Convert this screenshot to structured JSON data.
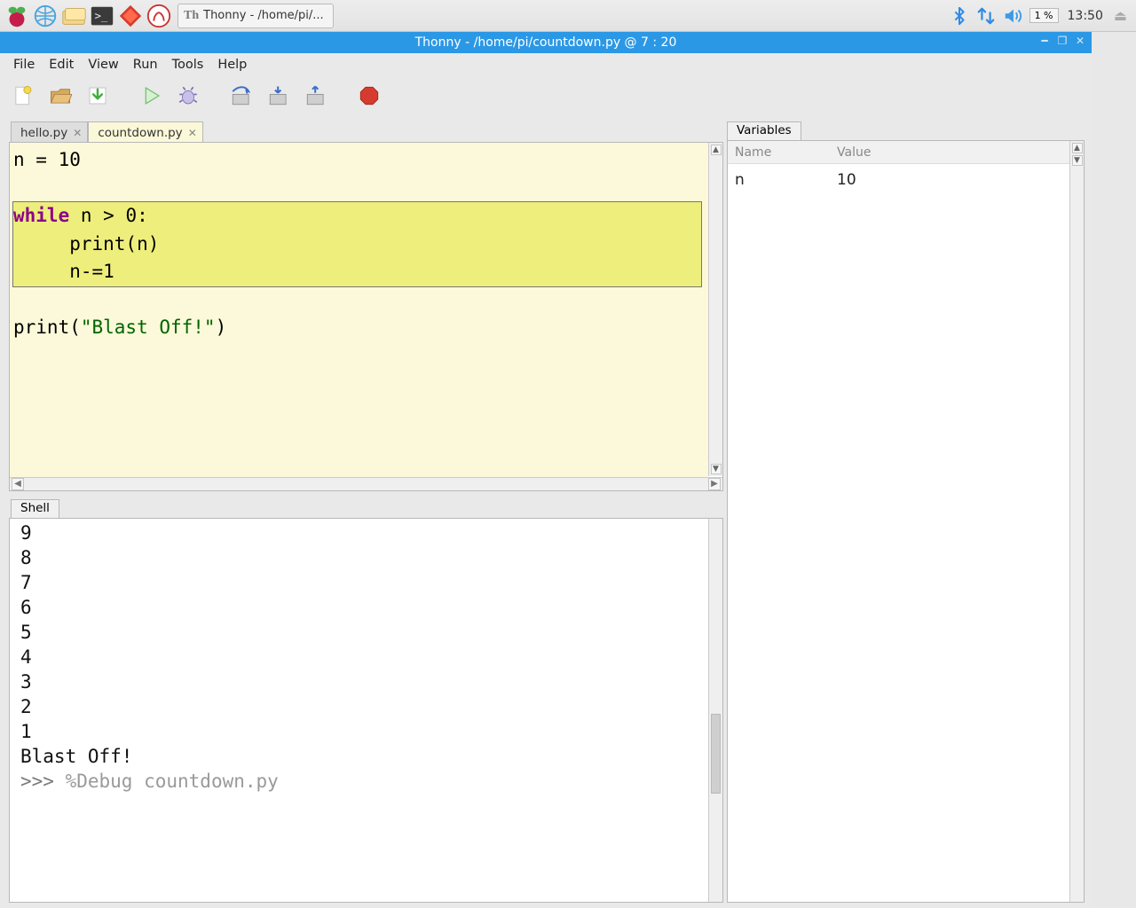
{
  "taskbar": {
    "task_label": "Thonny  -  /home/pi/...",
    "cpu": "1 %",
    "clock": "13:50"
  },
  "window": {
    "title": "Thonny  -  /home/pi/countdown.py  @  7 : 20"
  },
  "menu": {
    "file": "File",
    "edit": "Edit",
    "view": "View",
    "run": "Run",
    "tools": "Tools",
    "help": "Help"
  },
  "editor": {
    "tabs": [
      {
        "label": "hello.py",
        "active": false
      },
      {
        "label": "countdown.py",
        "active": true
      }
    ],
    "code": {
      "l1_a": "n = ",
      "l1_b": "10",
      "l3_kw": "while",
      "l3_rest": " n > ",
      "l3_num": "0",
      "l3_colon": ":",
      "l4": "     print(n)",
      "l5": "     n-=",
      "l5_num": "1",
      "l7_a": "print(",
      "l7_str": "\"Blast Off!\"",
      "l7_b": ")"
    }
  },
  "shell": {
    "tab": "Shell",
    "lines": [
      "9",
      "8",
      "7",
      "6",
      "5",
      "4",
      "3",
      "2",
      "1",
      "Blast Off!"
    ],
    "prompt": ">>> ",
    "cmd": "%Debug countdown.py"
  },
  "variables": {
    "tab": "Variables",
    "head_name": "Name",
    "head_value": "Value",
    "rows": [
      {
        "name": "n",
        "value": "10"
      }
    ]
  }
}
